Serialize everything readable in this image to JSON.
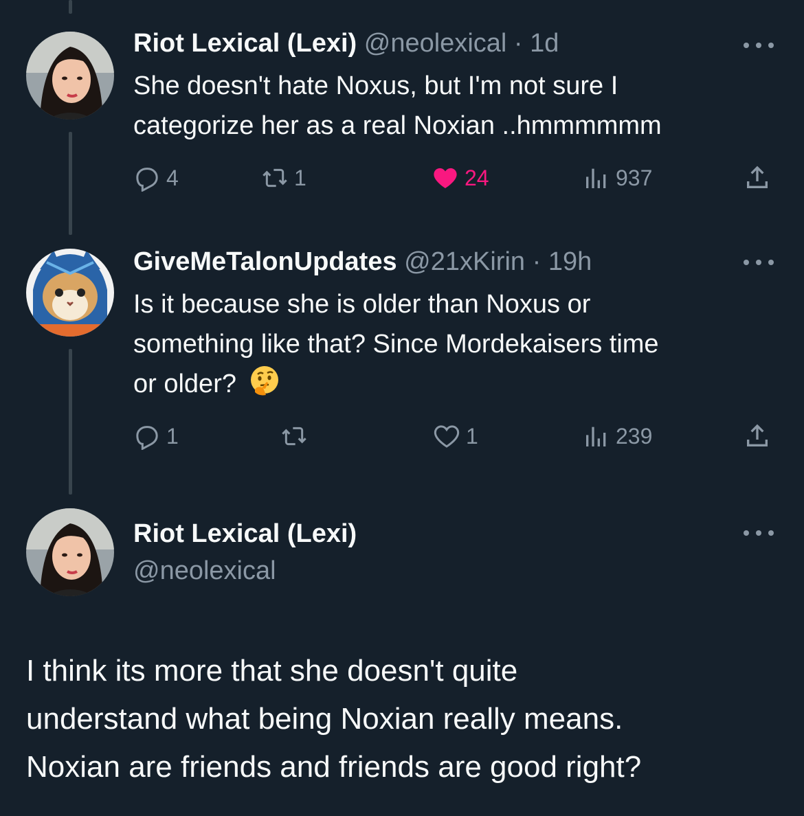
{
  "tweets": [
    {
      "display_name": "Riot Lexical (Lexi)",
      "handle": "@neolexical",
      "separator": "·",
      "time": "1d",
      "lines": [
        "She doesn't hate Noxus, but I'm not sure I",
        "categorize her as a real Noxian ..hmmmmmm"
      ],
      "replies": "4",
      "retweets": "1",
      "likes": "24",
      "liked": true,
      "views": "937"
    },
    {
      "display_name": "GiveMeTalonUpdates",
      "handle": "@21xKirin",
      "separator": "·",
      "time": "19h",
      "lines": [
        "Is it because she is older than Noxus or",
        "something like that? Since Mordekaisers time",
        "or older?"
      ],
      "emoji": "thinking-face",
      "replies": "1",
      "retweets": "",
      "likes": "1",
      "liked": false,
      "views": "239"
    }
  ],
  "focused": {
    "display_name": "Riot Lexical (Lexi)",
    "handle": "@neolexical",
    "lines": [
      "I think its more that she doesn't quite",
      "understand what being Noxian really means.",
      "Noxian are friends and friends are good right?"
    ]
  },
  "colors": {
    "background": "#15202b",
    "text": "#f7f9f9",
    "muted": "#8b98a5",
    "like": "#f91880",
    "thread_line": "#38444d"
  },
  "icons": [
    "reply-icon",
    "retweet-icon",
    "heart-icon",
    "views-icon",
    "share-icon",
    "more-icon"
  ]
}
